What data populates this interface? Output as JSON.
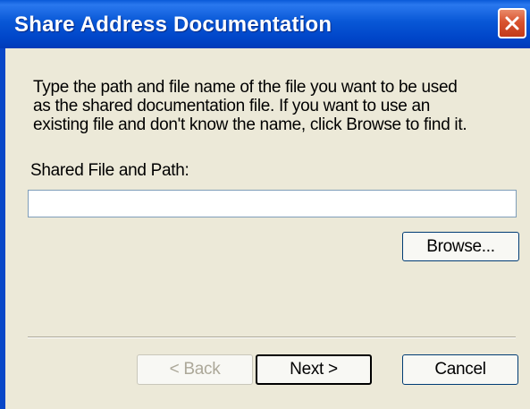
{
  "window": {
    "title": "Share Address Documentation"
  },
  "dialog": {
    "instructions": "Type the path and file name of the file you want to be used\nas the shared documentation file.  If you want to use an\nexisting file and don't know the name, click Browse to find it.",
    "field_label": "Shared File and Path:",
    "path_value": "",
    "browse_label": "Browse..."
  },
  "footer": {
    "back_label": "< Back",
    "next_label": "Next >",
    "cancel_label": "Cancel"
  },
  "icons": {
    "close": "close-icon"
  },
  "colors": {
    "titlebar": "#0857d6",
    "close_button": "#d9532f",
    "face": "#ece9d8"
  }
}
